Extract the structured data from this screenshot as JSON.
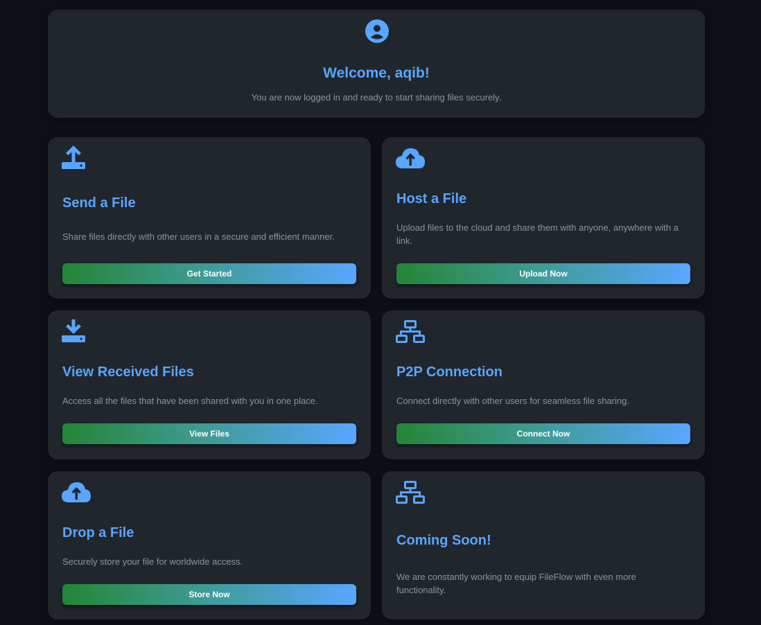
{
  "welcome": {
    "icon": "user-circle-icon",
    "title": "Welcome, aqib!",
    "subtitle": "You are now logged in and ready to start sharing files securely."
  },
  "cards": [
    {
      "icon": "upload-tray-icon",
      "title": "Send a File",
      "description": "Share files directly with other users in a secure and efficient manner.",
      "button": "Get Started"
    },
    {
      "icon": "cloud-upload-icon",
      "title": "Host a File",
      "description": "Upload files to the cloud and share them with anyone, anywhere with a link.",
      "button": "Upload Now"
    },
    {
      "icon": "download-tray-icon",
      "title": "View Received Files",
      "description": "Access all the files that have been shared with you in one place.",
      "button": "View Files"
    },
    {
      "icon": "network-icon",
      "title": "P2P Connection",
      "description": "Connect directly with other users for seamless file sharing.",
      "button": "Connect Now"
    },
    {
      "icon": "cloud-upload-icon",
      "title": "Drop a File",
      "description": "Securely store your file for worldwide access.",
      "button": "Store Now"
    },
    {
      "icon": "network-icon",
      "title": "Coming Soon!",
      "description": "We are constantly working to equip FileFlow with even more functionality."
    }
  ],
  "colors": {
    "background": "#0d1117",
    "card": "#21262d",
    "accent": "#58a6ff",
    "text_muted": "#8b949e",
    "gradient_start": "#238636",
    "gradient_end": "#58a6ff"
  }
}
